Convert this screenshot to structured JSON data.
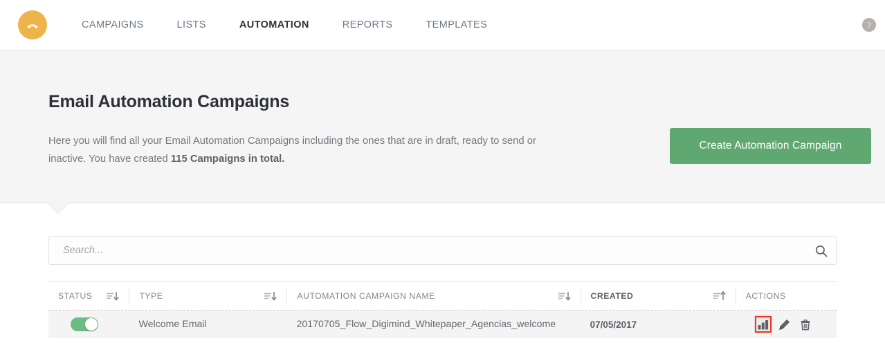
{
  "navbar": {
    "logo_name": "brand-logo",
    "links": [
      {
        "label": "CAMPAIGNS",
        "active": false
      },
      {
        "label": "LISTS",
        "active": false
      },
      {
        "label": "AUTOMATION",
        "active": true
      },
      {
        "label": "REPORTS",
        "active": false
      },
      {
        "label": "TEMPLATES",
        "active": false
      }
    ],
    "help_label": "?"
  },
  "hero": {
    "title": "Email Automation Campaigns",
    "description_part1": "Here you will find all your Email Automation Campaigns including the ones that are in draft, ready to send or inactive. You have created ",
    "description_highlight": "115 Campaigns in total.",
    "cta_label": "Create Automation Campaign",
    "cta_color": "#5fa871",
    "background_color": "#f5f5f5"
  },
  "search": {
    "value": "",
    "placeholder": "Search...",
    "icon": "search-icon"
  },
  "table": {
    "columns": [
      {
        "key": "status",
        "label": "STATUS",
        "sortable": true,
        "sort_dir": "down",
        "active": false
      },
      {
        "key": "type",
        "label": "TYPE",
        "sortable": true,
        "sort_dir": "down",
        "active": false
      },
      {
        "key": "name",
        "label": "AUTOMATION CAMPAIGN NAME",
        "sortable": true,
        "sort_dir": "down",
        "active": false
      },
      {
        "key": "created",
        "label": "CREATED",
        "sortable": true,
        "sort_dir": "up",
        "active": true
      },
      {
        "key": "actions",
        "label": "ACTIONS",
        "sortable": false,
        "sort_dir": "",
        "active": false
      }
    ],
    "rows": [
      {
        "status_on": true,
        "type": "Welcome Email",
        "name": "20170705_Flow_Digimind_Whitepaper_Agencias_welcome",
        "created": "07/05/2017",
        "actions": [
          {
            "name": "stats-icon",
            "highlighted": true
          },
          {
            "name": "edit-icon",
            "highlighted": false
          },
          {
            "name": "delete-icon",
            "highlighted": false
          }
        ]
      }
    ]
  },
  "colors": {
    "toggle_on": "#6fbb85",
    "highlight_box": "#f0351f",
    "brand": "#eeb34a"
  }
}
